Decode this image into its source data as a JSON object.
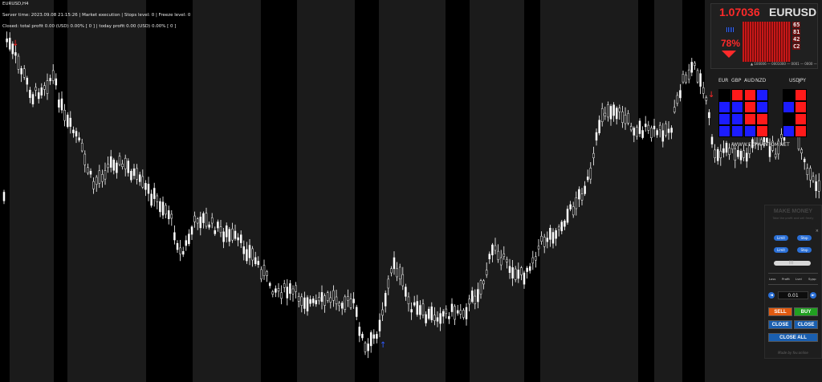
{
  "chart": {
    "title": "EURUSD,H4",
    "info_line": "Server time: 2023.09.08 21:15:26  |  Market execution  |  Stops level: 0  |  Freeze level: 0",
    "closed_line": "Closed: total profit 0.00 (USD)  0.00% [ 0 ]  |  today profit 0.00 (USD)  0.00% [ 0 ]",
    "colors": {
      "background": "#000000",
      "band_light": "#1b1b1b",
      "candle": "#ffffff",
      "sell_arrow": "#ff2a2a",
      "buy_arrow": "#2f5bff"
    }
  },
  "price_panel": {
    "price": "1.07036",
    "symbol": "EURUSD",
    "percent": "78%",
    "digits": [
      "65",
      "81",
      "42",
      "C2"
    ],
    "footer_text": "▲ 100006 — 0001000 — 0001 — 0000 —"
  },
  "currency_strength": {
    "labels": [
      "EUR",
      "GBP",
      "AUD",
      "NZD",
      "USD",
      "JPY"
    ],
    "grid": [
      [
        "black",
        "red",
        "red",
        "blue",
        "black",
        "red"
      ],
      [
        "blue",
        "blue",
        "red",
        "blue",
        "blue",
        "red"
      ],
      [
        "blue",
        "blue",
        "red",
        "red",
        "black",
        "red"
      ],
      [
        "blue",
        "blue",
        "blue",
        "red",
        "blue",
        "red"
      ]
    ],
    "site": "WWW.FXPHANTOM.NET",
    "colors": {
      "red": "#ff1a1a",
      "blue": "#1c1cff",
      "black": "#000000"
    }
  },
  "trade_panel": {
    "brand": "MAKE MONEY",
    "subtitle": "Take the profit and sell freely",
    "close_x": "×",
    "limit_1": "Limit",
    "stop_1": "Stop",
    "limit_2": "Limit",
    "stop_2": "Stop",
    "slider_value": "|||",
    "row_labels": [
      "Loss",
      "Profit",
      "Lvel",
      "Sypp"
    ],
    "lot": "0.01",
    "minus": "◄",
    "plus": "►",
    "sell": "SELL",
    "buy": "BUY",
    "close_left": "CLOSE",
    "close_right": "CLOSE",
    "close_all": "CLOSE ALL",
    "footer": "Made by fxv.online",
    "colors": {
      "sell": "#e05a10",
      "buy": "#21a021",
      "close": "#1a5fb0"
    }
  }
}
